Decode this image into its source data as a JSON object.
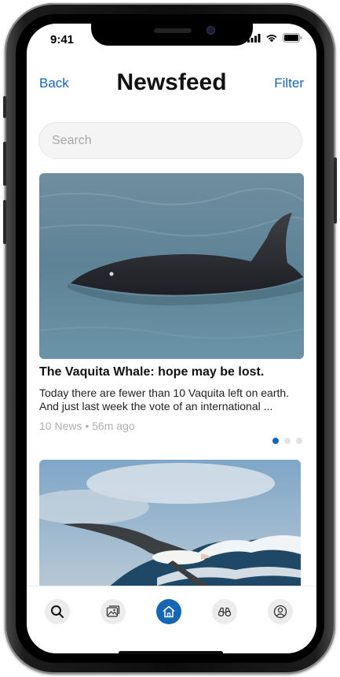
{
  "status_bar": {
    "time": "9:41"
  },
  "nav": {
    "back_label": "Back",
    "title": "Newsfeed",
    "filter_label": "Filter"
  },
  "search": {
    "placeholder": "Search"
  },
  "article": {
    "title": "The Vaquita Whale: hope may be lost.",
    "body": "Today there are fewer than 10 Vaquita left on earth. And just last week the vote of an international ...",
    "meta": "10 News • 56m ago",
    "image": "vaquita-photo",
    "pagination": {
      "total": 3,
      "active": 1
    }
  },
  "next_article": {
    "image": "albatross-over-waves-photo"
  },
  "tab_bar": {
    "active_tab": "home",
    "tabs": [
      {
        "id": "search",
        "icon": "search-icon"
      },
      {
        "id": "gallery",
        "icon": "images-icon"
      },
      {
        "id": "home",
        "icon": "home-icon"
      },
      {
        "id": "explore",
        "icon": "binoculars-icon"
      },
      {
        "id": "profile",
        "icon": "user-icon"
      }
    ]
  },
  "colors": {
    "accent": "#1566b5",
    "muted_text": "#b0b0b0",
    "inactive_tab": "#ececec"
  }
}
